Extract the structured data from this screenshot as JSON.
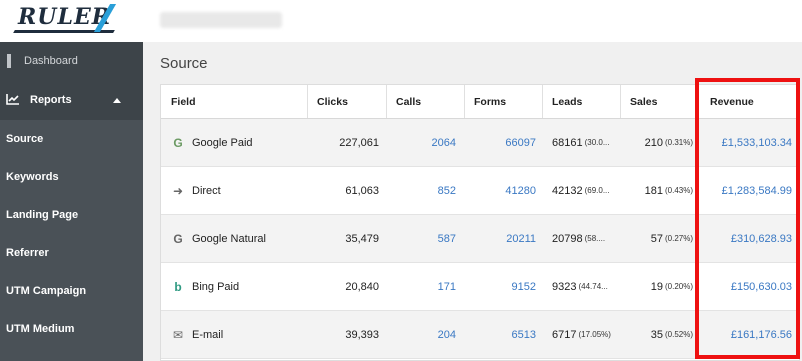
{
  "brand": {
    "logo_text": "RULER"
  },
  "sidebar": {
    "dashboard_label": "Dashboard",
    "reports_label": "Reports",
    "sub_items": [
      {
        "label": "Source"
      },
      {
        "label": "Keywords"
      },
      {
        "label": "Landing Page"
      },
      {
        "label": "Referrer"
      },
      {
        "label": "UTM Campaign"
      },
      {
        "label": "UTM Medium"
      }
    ]
  },
  "page": {
    "section_title": "Source"
  },
  "table": {
    "columns": [
      "Field",
      "Clicks",
      "Calls",
      "Forms",
      "Leads",
      "Sales",
      "Revenue"
    ],
    "rows": [
      {
        "icon": "google-icon",
        "field": "Google Paid",
        "clicks": "227,061",
        "calls": "2064",
        "forms": "66097",
        "leads": "68161",
        "leads_pct": "(30.0...",
        "sales": "210",
        "sales_pct": "(0.31%)",
        "revenue": "£1,533,103.34"
      },
      {
        "icon": "direct-arrow-icon",
        "field": "Direct",
        "clicks": "61,063",
        "calls": "852",
        "forms": "41280",
        "leads": "42132",
        "leads_pct": "(69.0...",
        "sales": "181",
        "sales_pct": "(0.43%)",
        "revenue": "£1,283,584.99"
      },
      {
        "icon": "google-icon",
        "field": "Google Natural",
        "clicks": "35,479",
        "calls": "587",
        "forms": "20211",
        "leads": "20798",
        "leads_pct": "(58....",
        "sales": "57",
        "sales_pct": "(0.27%)",
        "revenue": "£310,628.93"
      },
      {
        "icon": "bing-icon",
        "field": "Bing Paid",
        "clicks": "20,840",
        "calls": "171",
        "forms": "9152",
        "leads": "9323",
        "leads_pct": "(44.74...",
        "sales": "19",
        "sales_pct": "(0.20%)",
        "revenue": "£150,630.03"
      },
      {
        "icon": "email-icon",
        "field": "E-mail",
        "clicks": "39,393",
        "calls": "204",
        "forms": "6513",
        "leads": "6717",
        "leads_pct": "(17.05%)",
        "sales": "35",
        "sales_pct": "(0.52%)",
        "revenue": "£161,176.56"
      }
    ]
  },
  "colors": {
    "sidebar": "#4a5157",
    "link": "#3a78c3",
    "highlight": "#ee1111",
    "accent": "#2a9fd8"
  }
}
